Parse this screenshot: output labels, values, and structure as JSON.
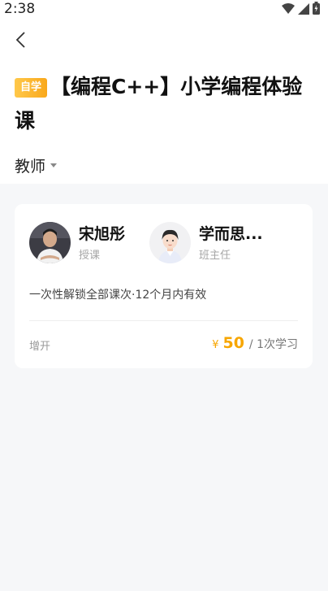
{
  "status_bar": {
    "time": "2:38",
    "icons": [
      "wifi-icon",
      "signal-icon",
      "battery-icon"
    ]
  },
  "header": {
    "back_icon": "chevron-left-icon"
  },
  "course": {
    "badge": "自学",
    "title": "【编程C++】小学编程体验课",
    "badge_color": "#f9a81b"
  },
  "filter": {
    "teacher_label": "教师",
    "icon": "caret-down-icon"
  },
  "card": {
    "teachers": [
      {
        "name": "宋旭彤",
        "role": "授课"
      },
      {
        "name": "学而思...",
        "role": "班主任"
      }
    ],
    "description": "一次性解锁全部课次·12个月内有效",
    "footer_left": "增开",
    "price": {
      "currency": "¥",
      "amount": "50",
      "unit": "/ 1次学习"
    },
    "accent_color": "#f7a600"
  }
}
